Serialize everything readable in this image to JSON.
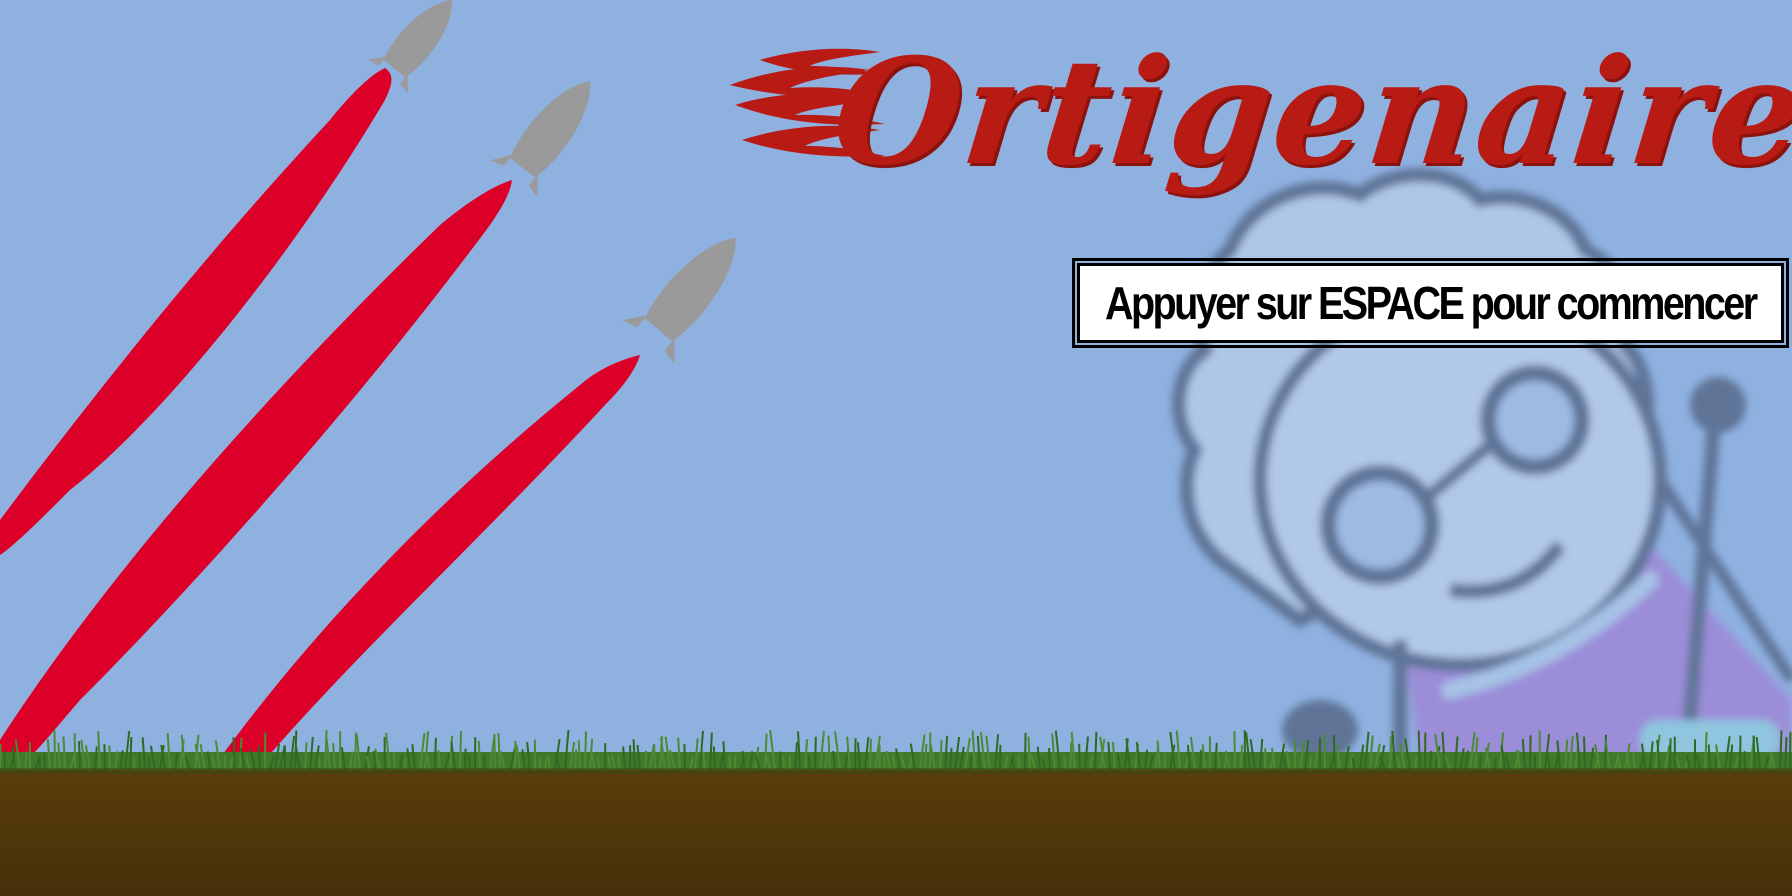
{
  "game": {
    "title": "Ortigenaire",
    "start_prompt": "Appuyer sur ESPACE pour commencer"
  },
  "colors": {
    "sky": "#8fb1e0",
    "title_red": "#b81a14",
    "rocket_trail": "#dc0028",
    "rocket_body": "#9a9a9a",
    "character_outline": "#5a6e90",
    "character_face": "#b3c9ea",
    "character_shirt": "#9d8ad8",
    "grass": "#3f7a2a",
    "soil": "#4a3209"
  },
  "icons": {
    "rockets": [
      "rocket-icon",
      "rocket-icon",
      "rocket-icon"
    ],
    "flames": "flame-icon",
    "character": "grandma-character"
  }
}
